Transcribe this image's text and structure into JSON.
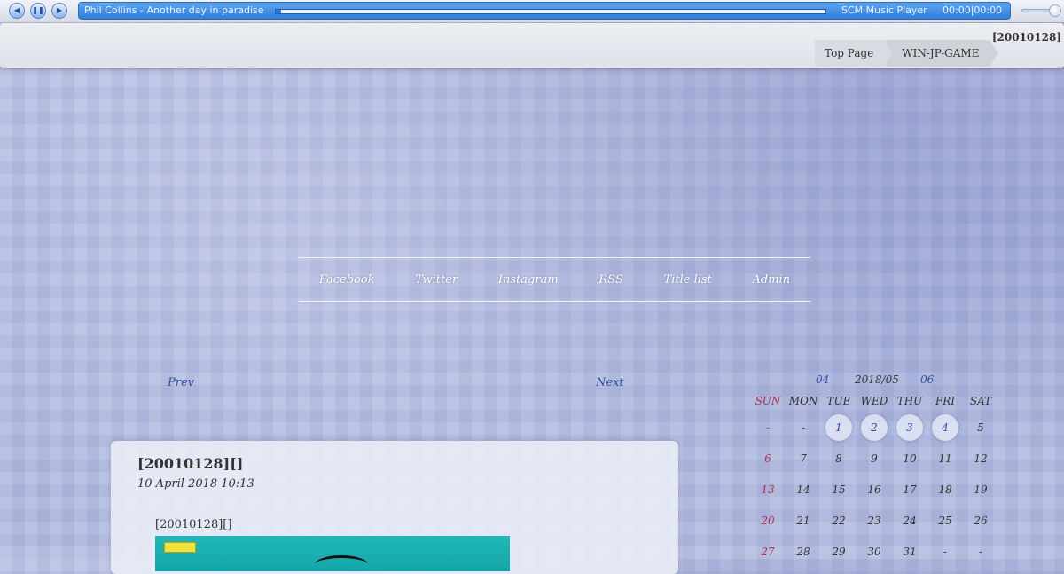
{
  "player": {
    "track_title": "Phil Collins - Another day in paradise",
    "player_name": "SCM Music Player",
    "time": "00:00|00:00",
    "progress": 0.01,
    "volume": 0.9,
    "accent_color": "#2f7fdc"
  },
  "header": {
    "code": "[20010128]",
    "breadcrumb": [
      "Top Page",
      "WIN-JP-GAME"
    ]
  },
  "nav": {
    "items": [
      "Facebook",
      "Twitter",
      "Instagram",
      "RSS",
      "Title list",
      "Admin"
    ]
  },
  "pager": {
    "prev": "Prev",
    "next": "Next"
  },
  "post": {
    "title": "[20010128][]",
    "date": "10 April 2018 10:13",
    "body_title": "[20010128][]"
  },
  "calendar": {
    "prev": "04",
    "month": "2018/05",
    "next": "06",
    "weekdays": [
      "SUN",
      "MON",
      "TUE",
      "WED",
      "THU",
      "FRI",
      "SAT"
    ],
    "weeks": [
      [
        "-",
        "-",
        "1",
        "2",
        "3",
        "4",
        "5"
      ],
      [
        "6",
        "7",
        "8",
        "9",
        "10",
        "11",
        "12"
      ],
      [
        "13",
        "14",
        "15",
        "16",
        "17",
        "18",
        "19"
      ],
      [
        "20",
        "21",
        "22",
        "23",
        "24",
        "25",
        "26"
      ],
      [
        "27",
        "28",
        "29",
        "30",
        "31",
        "-",
        "-"
      ]
    ],
    "marked_days": [
      "1",
      "2",
      "3",
      "4"
    ],
    "sunday_color": "#b03050"
  }
}
